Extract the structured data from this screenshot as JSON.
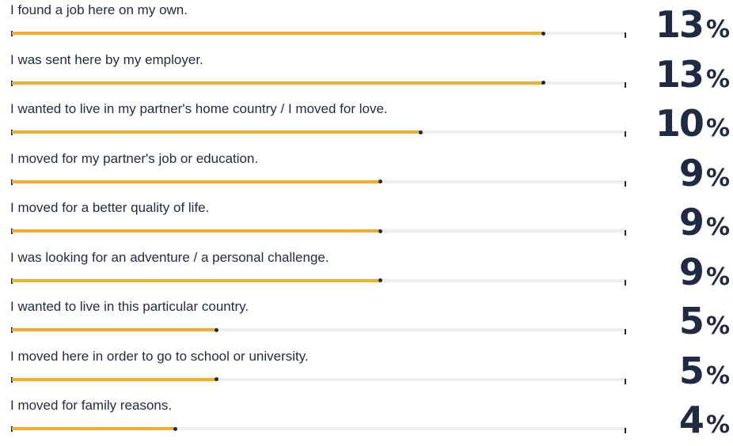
{
  "chart_data": {
    "type": "bar",
    "orientation": "horizontal",
    "xlim": [
      0,
      15
    ],
    "percent_sign": "%",
    "bar_color": "#f5ac2a",
    "track_color": "#ededed",
    "text_color": "#1f2a44",
    "categories": [
      "I found a job here on my own.",
      "I was sent here by my employer.",
      "I wanted to live in my partner's home country / I moved for love.",
      "I moved for my partner's job or education.",
      "I moved for a better quality of life.",
      "I was looking for an adventure / a personal challenge.",
      "I wanted to live in this particular country.",
      "I moved here in order to go to school or university.",
      "I moved for family reasons."
    ],
    "values": [
      13,
      13,
      10,
      9,
      9,
      9,
      5,
      5,
      4
    ]
  }
}
